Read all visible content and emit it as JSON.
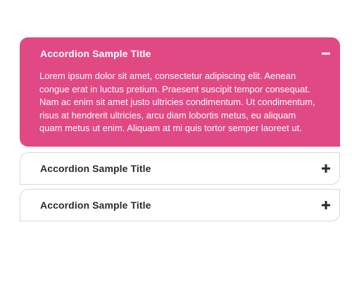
{
  "accordion": {
    "items": [
      {
        "title": "Accordion Sample Title",
        "expanded": true,
        "toggle_icon": "minus-icon",
        "body": "Lorem ipsum dolor sit amet, consectetur adipiscing elit. Aenean congue erat in luctus pretium. Praesent suscipit tempor consequat. Nam ac enim sit amet justo ultricies condimentum. Ut condimentum, risus at hendrerit ultricies, arcu diam lobortis metus, eu aliquam quam metus ut enim. Aliquam at mi quis tortor semper laoreet ut."
      },
      {
        "title": "Accordion Sample Title",
        "expanded": false,
        "toggle_icon": "plus-icon"
      },
      {
        "title": "Accordion Sample Title",
        "expanded": false,
        "toggle_icon": "plus-icon"
      }
    ]
  },
  "colors": {
    "active_background": "#e14985",
    "inactive_background": "#ffffff",
    "border": "#d9d9d9",
    "title_text": "#2b2b2b",
    "active_text": "#ffffff"
  }
}
